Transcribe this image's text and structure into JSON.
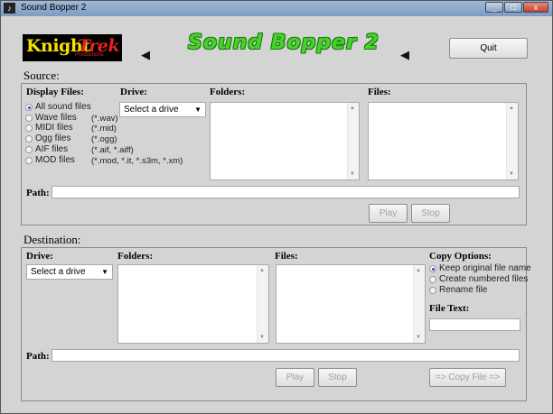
{
  "window": {
    "title": "Sound Bopper 2",
    "app_icon": "speaker-app-icon",
    "controls": {
      "minimize": "_",
      "maximize": "□",
      "close": "x"
    }
  },
  "header": {
    "logo": {
      "brand_a": "Knight",
      "brand_b": "Trek",
      "tagline": "Productions"
    },
    "app_title": "Sound Bopper 2",
    "left_icon": "speaker-left-icon",
    "right_icon": "speaker-right-icon",
    "quit_label": "Quit"
  },
  "source": {
    "label": "Source:",
    "display_files_header": "Display Files:",
    "drive_header": "Drive:",
    "folders_header": "Folders:",
    "files_header": "Files:",
    "file_types": [
      {
        "label": "All sound files",
        "ext": "",
        "selected": true
      },
      {
        "label": "Wave files",
        "ext": "(*.wav)",
        "selected": false
      },
      {
        "label": "MIDI files",
        "ext": "(*.mid)",
        "selected": false
      },
      {
        "label": "Ogg files",
        "ext": "(*.ogg)",
        "selected": false
      },
      {
        "label": "AIF files",
        "ext": "(*.aif, *.aiff)",
        "selected": false
      },
      {
        "label": "MOD files",
        "ext": "(*.mod, *.it, *.s3m, *.xm)",
        "selected": false
      }
    ],
    "drive_select": "Select a drive",
    "path_label": "Path:",
    "path_value": "",
    "play_label": "Play",
    "stop_label": "Stop"
  },
  "destination": {
    "label": "Destination:",
    "drive_header": "Drive:",
    "folders_header": "Folders:",
    "files_header": "Files:",
    "copy_options_header": "Copy Options:",
    "copy_options": [
      {
        "label": "Keep original file name",
        "selected": true
      },
      {
        "label": "Create numbered files",
        "selected": false
      },
      {
        "label": "Rename file",
        "selected": false
      }
    ],
    "file_text_label": "File Text:",
    "file_text_value": "",
    "drive_select": "Select a drive",
    "path_label": "Path:",
    "path_value": "",
    "play_label": "Play",
    "stop_label": "Stop",
    "copy_label": "=> Copy File =>"
  }
}
